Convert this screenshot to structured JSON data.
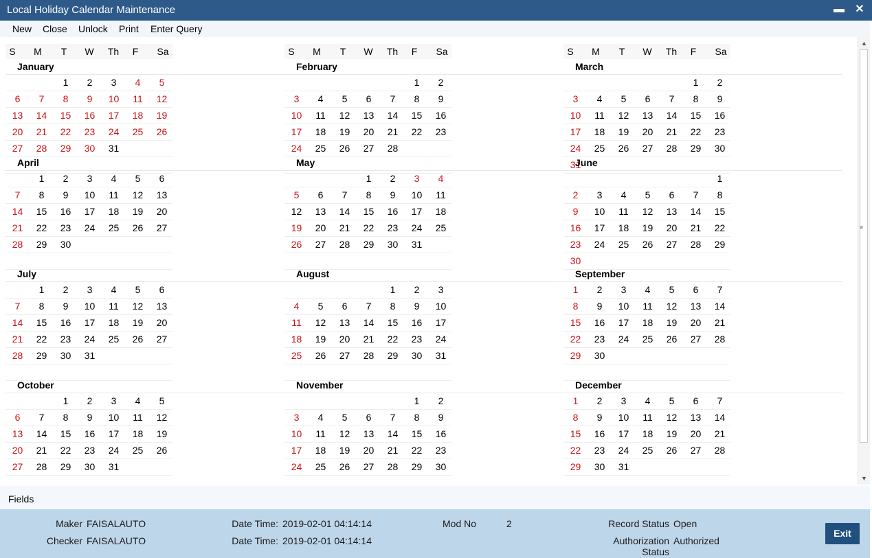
{
  "window": {
    "title": "Local Holiday Calendar Maintenance",
    "minimize_glyph": "▬",
    "close_glyph": "✕"
  },
  "menu": {
    "items": [
      "New",
      "Close",
      "Unlock",
      "Print",
      "Enter Query"
    ]
  },
  "weekday_headers": [
    "S",
    "M",
    "T",
    "W",
    "Th",
    "F",
    "Sa"
  ],
  "colors": {
    "holiday": "#cc1111",
    "titlebar": "#2e5a8a",
    "footer": "#bed6ea",
    "exit_button": "#21507e"
  },
  "months": [
    {
      "name": "January",
      "weeks": [
        [
          0,
          0,
          0,
          1,
          2,
          3,
          4,
          5
        ],
        [
          6,
          7,
          8,
          9,
          10,
          11,
          12
        ],
        [
          13,
          14,
          15,
          16,
          17,
          18,
          19
        ],
        [
          20,
          21,
          22,
          23,
          24,
          25,
          26
        ],
        [
          27,
          28,
          29,
          30,
          31,
          0,
          0
        ],
        []
      ],
      "holidays": [
        4,
        5,
        6,
        7,
        8,
        9,
        10,
        11,
        12,
        13,
        14,
        15,
        16,
        17,
        18,
        19,
        20,
        21,
        22,
        23,
        24,
        25,
        26,
        27,
        28,
        29,
        30
      ]
    },
    {
      "name": "February",
      "weeks": [
        [
          0,
          0,
          0,
          0,
          0,
          0,
          1,
          2
        ],
        [
          3,
          4,
          5,
          6,
          7,
          8,
          9
        ],
        [
          10,
          11,
          12,
          13,
          14,
          15,
          16
        ],
        [
          17,
          18,
          19,
          20,
          21,
          22,
          23
        ],
        [
          24,
          25,
          26,
          27,
          28,
          0,
          0
        ],
        []
      ],
      "holidays": [
        3,
        10,
        17,
        24
      ]
    },
    {
      "name": "March",
      "weeks": [
        [
          0,
          0,
          0,
          0,
          0,
          0,
          1,
          2
        ],
        [
          3,
          4,
          5,
          6,
          7,
          8,
          9
        ],
        [
          10,
          11,
          12,
          13,
          14,
          15,
          16
        ],
        [
          17,
          18,
          19,
          20,
          21,
          22,
          23
        ],
        [
          24,
          25,
          26,
          27,
          28,
          29,
          30
        ],
        [
          31,
          0,
          0,
          0,
          0,
          0,
          0
        ]
      ],
      "holidays": [
        3,
        10,
        17,
        24,
        31
      ]
    },
    {
      "name": "April",
      "weeks": [
        [
          0,
          1,
          2,
          3,
          4,
          5,
          6
        ],
        [
          7,
          8,
          9,
          10,
          11,
          12,
          13
        ],
        [
          14,
          15,
          16,
          17,
          18,
          19,
          20
        ],
        [
          21,
          22,
          23,
          24,
          25,
          26,
          27
        ],
        [
          28,
          29,
          30,
          0,
          0,
          0,
          0
        ],
        []
      ],
      "holidays": [
        7,
        14,
        21,
        28
      ]
    },
    {
      "name": "May",
      "weeks": [
        [
          0,
          0,
          0,
          0,
          1,
          2,
          3,
          4
        ],
        [
          5,
          6,
          7,
          8,
          9,
          10,
          11
        ],
        [
          12,
          13,
          14,
          15,
          16,
          17,
          18
        ],
        [
          19,
          20,
          21,
          22,
          23,
          24,
          25
        ],
        [
          26,
          27,
          28,
          29,
          30,
          31,
          0
        ],
        []
      ],
      "holidays": [
        3,
        4,
        5,
        19,
        26
      ]
    },
    {
      "name": "June",
      "weeks": [
        [
          0,
          0,
          0,
          0,
          0,
          0,
          0,
          1
        ],
        [
          2,
          3,
          4,
          5,
          6,
          7,
          8
        ],
        [
          9,
          10,
          11,
          12,
          13,
          14,
          15
        ],
        [
          16,
          17,
          18,
          19,
          20,
          21,
          22
        ],
        [
          23,
          24,
          25,
          26,
          27,
          28,
          29
        ],
        [
          30,
          0,
          0,
          0,
          0,
          0,
          0
        ]
      ],
      "holidays": [
        2,
        9,
        16,
        23,
        30
      ]
    },
    {
      "name": "July",
      "weeks": [
        [
          0,
          1,
          2,
          3,
          4,
          5,
          6
        ],
        [
          7,
          8,
          9,
          10,
          11,
          12,
          13
        ],
        [
          14,
          15,
          16,
          17,
          18,
          19,
          20
        ],
        [
          21,
          22,
          23,
          24,
          25,
          26,
          27
        ],
        [
          28,
          29,
          30,
          31,
          0,
          0,
          0
        ],
        []
      ],
      "holidays": [
        7,
        14,
        21,
        28
      ]
    },
    {
      "name": "August",
      "weeks": [
        [
          0,
          0,
          0,
          0,
          0,
          1,
          2,
          3
        ],
        [
          4,
          5,
          6,
          7,
          8,
          9,
          10
        ],
        [
          11,
          12,
          13,
          14,
          15,
          16,
          17
        ],
        [
          18,
          19,
          20,
          21,
          22,
          23,
          24
        ],
        [
          25,
          26,
          27,
          28,
          29,
          30,
          31
        ],
        []
      ],
      "holidays": [
        4,
        11,
        18,
        25
      ]
    },
    {
      "name": "September",
      "weeks": [
        [
          1,
          2,
          3,
          4,
          5,
          6,
          7
        ],
        [
          8,
          9,
          10,
          11,
          12,
          13,
          14
        ],
        [
          15,
          16,
          17,
          18,
          19,
          20,
          21
        ],
        [
          22,
          23,
          24,
          25,
          26,
          27,
          28
        ],
        [
          29,
          30,
          0,
          0,
          0,
          0,
          0
        ],
        []
      ],
      "holidays": [
        1,
        8,
        15,
        22,
        29
      ]
    },
    {
      "name": "October",
      "weeks": [
        [
          0,
          0,
          1,
          2,
          3,
          4,
          5
        ],
        [
          6,
          7,
          8,
          9,
          10,
          11,
          12
        ],
        [
          13,
          14,
          15,
          16,
          17,
          18,
          19
        ],
        [
          20,
          21,
          22,
          23,
          24,
          25,
          26
        ],
        [
          27,
          28,
          29,
          30,
          31,
          0,
          0
        ],
        []
      ],
      "holidays": [
        6,
        13,
        20,
        27
      ]
    },
    {
      "name": "November",
      "weeks": [
        [
          0,
          0,
          0,
          0,
          0,
          1,
          2
        ],
        [
          3,
          4,
          5,
          6,
          7,
          8,
          9
        ],
        [
          10,
          11,
          12,
          13,
          14,
          15,
          16
        ],
        [
          17,
          18,
          19,
          20,
          21,
          22,
          23
        ],
        [
          24,
          25,
          26,
          27,
          28,
          29,
          30
        ],
        []
      ],
      "holidays": [
        3,
        10,
        17,
        24
      ]
    },
    {
      "name": "December",
      "weeks": [
        [
          1,
          2,
          3,
          4,
          5,
          6,
          7
        ],
        [
          8,
          9,
          10,
          11,
          12,
          13,
          14
        ],
        [
          15,
          16,
          17,
          18,
          19,
          20,
          21
        ],
        [
          22,
          23,
          24,
          25,
          26,
          27,
          28
        ],
        [
          29,
          30,
          31,
          0,
          0,
          0,
          0
        ],
        []
      ],
      "holidays": [
        1,
        8,
        15,
        22,
        29
      ]
    }
  ],
  "fields_label": "Fields",
  "footer": {
    "maker_label": "Maker",
    "maker": "FAISALAUTO",
    "checker_label": "Checker",
    "checker": "FAISALAUTO",
    "datetime_label": "Date Time:",
    "maker_datetime": "2019-02-01 04:14:14",
    "checker_datetime": "2019-02-01 04:14:14",
    "mod_no_label": "Mod No",
    "mod_no": "2",
    "record_status_label": "Record Status",
    "record_status": "Open",
    "auth_status_label_1": "Authorization",
    "auth_status_label_2": "Status",
    "auth_status": "Authorized",
    "exit_label": "Exit"
  }
}
